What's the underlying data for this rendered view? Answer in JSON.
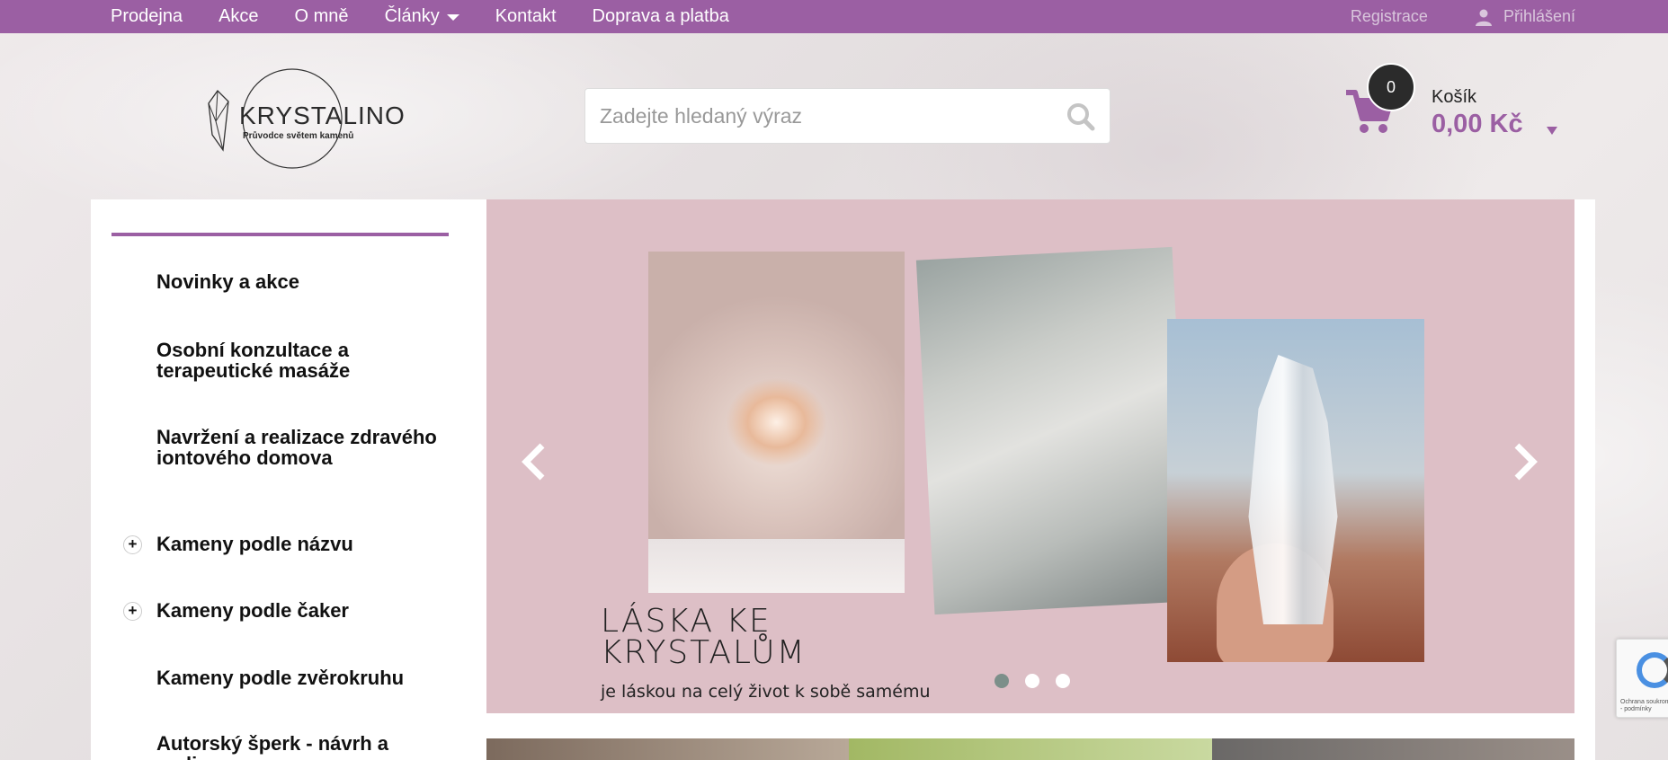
{
  "topnav": {
    "items": [
      {
        "label": "Prodejna"
      },
      {
        "label": "Akce"
      },
      {
        "label": "O mně"
      },
      {
        "label": "Články",
        "has_dropdown": true
      },
      {
        "label": "Kontakt"
      },
      {
        "label": "Doprava a platba"
      }
    ],
    "register_label": "Registrace",
    "login_label": "Přihlášení"
  },
  "logo": {
    "title": "KRYSTALINO",
    "subtitle": "Průvodce světem kamenů"
  },
  "search": {
    "placeholder": "Zadejte hledaný výraz",
    "value": ""
  },
  "cart": {
    "count": "0",
    "label": "Košík",
    "total": "0,00 Kč"
  },
  "sidebar": {
    "items": [
      {
        "label": "Novinky a akce",
        "expandable": false
      },
      {
        "label": "Osobní konzultace a terapeutické masáže",
        "expandable": false
      },
      {
        "label": "Navržení a realizace zdravého iontového domova",
        "expandable": false
      },
      {
        "label": "Kameny podle názvu",
        "expandable": true
      },
      {
        "label": "Kameny podle čaker",
        "expandable": true
      },
      {
        "label": "Kameny podle zvěrokruhu",
        "expandable": false
      },
      {
        "label": "Autorský šperk - návrh a realizace",
        "expandable": false
      }
    ]
  },
  "slider": {
    "title_line1": "LÁSKA KE",
    "title_line2": "KRYSTALŮM",
    "subtitle": "je láskou na celý život k sobě samému",
    "active_dot": 1,
    "dot_count": 3
  },
  "recaptcha": {
    "text": "Ochrana soukromí - podmínky"
  },
  "colors": {
    "brand": "#9b5fa3",
    "slider_bg": "#ddbfc6",
    "dark": "#2b2b2b"
  }
}
